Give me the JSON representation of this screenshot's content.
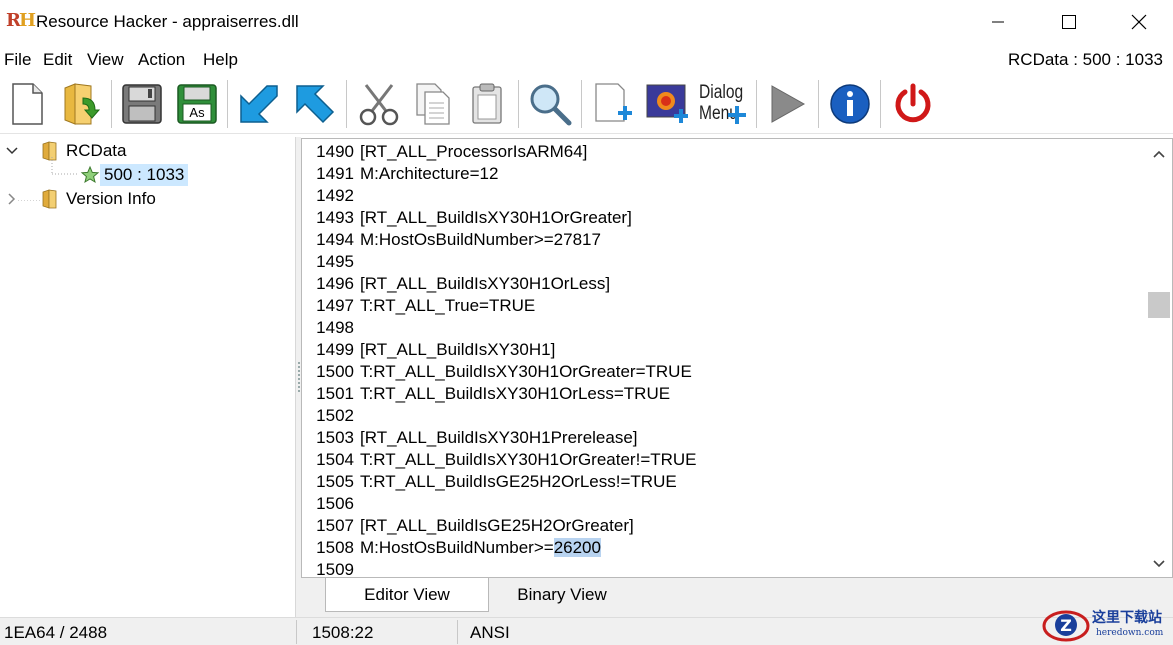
{
  "window": {
    "logo_r": "R",
    "logo_h": "H",
    "title": "Resource Hacker - appraiserres.dll"
  },
  "menu": {
    "items": [
      "File",
      "Edit",
      "View",
      "Action",
      "Help"
    ],
    "resource_indicator": "RCData : 500 : 1033"
  },
  "toolbar": {
    "dialog_menu_line1": "Dialog",
    "dialog_menu_line2": "Menu",
    "icons": [
      "new-file-icon",
      "open-folder-icon",
      "save-icon",
      "save-as-icon",
      "back-arrow-icon",
      "forward-arrow-icon",
      "cut-icon",
      "copy-icon",
      "paste-icon",
      "search-icon",
      "add-resource-icon",
      "add-image-icon",
      "dialog-menu-icon",
      "run-icon",
      "info-icon",
      "power-icon"
    ],
    "save_as_label": "As"
  },
  "tree": {
    "root": "RCData",
    "child": "500 : 1033",
    "version": "Version Info"
  },
  "editor": {
    "line_numbers": [
      "1490",
      "1491",
      "1492",
      "1493",
      "1494",
      "1495",
      "1496",
      "1497",
      "1498",
      "1499",
      "1500",
      "1501",
      "1502",
      "1503",
      "1504",
      "1505",
      "1506",
      "1507",
      "1508",
      "1509"
    ],
    "lines": [
      "[RT_ALL_ProcessorIsARM64]",
      "M:Architecture=12",
      "",
      "[RT_ALL_BuildIsXY30H1OrGreater]",
      "M:HostOsBuildNumber>=27817",
      "",
      "[RT_ALL_BuildIsXY30H1OrLess]",
      "T:RT_ALL_True=TRUE",
      "",
      "[RT_ALL_BuildIsXY30H1]",
      "T:RT_ALL_BuildIsXY30H1OrGreater=TRUE",
      "T:RT_ALL_BuildIsXY30H1OrLess=TRUE",
      "",
      "[RT_ALL_BuildIsXY30H1Prerelease]",
      "T:RT_ALL_BuildIsXY30H1OrGreater!=TRUE",
      "T:RT_ALL_BuildIsGE25H2OrLess!=TRUE",
      "",
      "[RT_ALL_BuildIsGE25H2OrGreater]",
      "M:HostOsBuildNumber>=",
      ""
    ],
    "selected_text": "26200"
  },
  "tabs": {
    "editor_view": "Editor View",
    "binary_view": "Binary View"
  },
  "status": {
    "offset": "1EA64 / 2488",
    "position": "1508:22",
    "encoding": "ANSI"
  },
  "watermark": {
    "cn": "这里下载站",
    "en": "heredown.com"
  }
}
